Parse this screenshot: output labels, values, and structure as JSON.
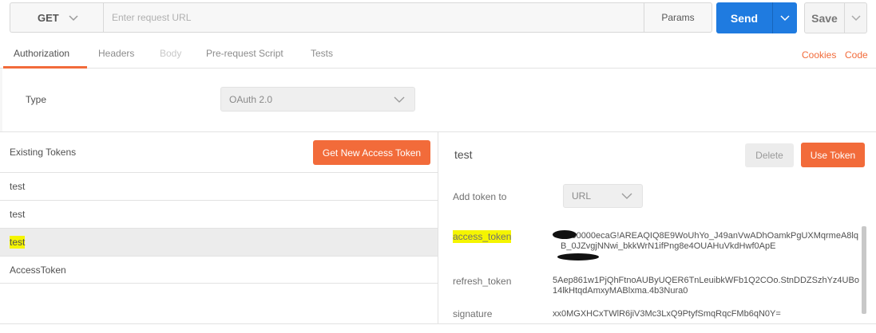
{
  "request": {
    "method": "GET",
    "url_value": "",
    "url_placeholder": "Enter request URL",
    "params_label": "Params",
    "send_label": "Send",
    "save_label": "Save"
  },
  "tabs": [
    {
      "label": "Authorization",
      "state": "active"
    },
    {
      "label": "Headers",
      "state": "normal"
    },
    {
      "label": "Body",
      "state": "disabled"
    },
    {
      "label": "Pre-request Script",
      "state": "normal"
    },
    {
      "label": "Tests",
      "state": "normal"
    }
  ],
  "links": {
    "cookies": "Cookies",
    "code": "Code"
  },
  "auth": {
    "type_label": "Type",
    "type_value": "OAuth 2.0"
  },
  "tokens": {
    "header": "Existing Tokens",
    "new_button": "Get New Access Token",
    "items": [
      {
        "name": "test"
      },
      {
        "name": "test"
      },
      {
        "name": "test"
      },
      {
        "name": "AccessToken"
      }
    ]
  },
  "detail": {
    "title": "test",
    "delete_label": "Delete",
    "use_label": "Use Token",
    "add_to_label": "Add token to",
    "add_to_value": "URL",
    "fields": [
      {
        "label": "access_token",
        "value": "A000000ecaG!AREAQIQ8E9WoUhYo_J49anVwADhOamkPgUXMqrmeA8lqB_0JZvgjNNwi_bkkWrN1ifPng8e4OUAHuVkdHwf0ApE"
      },
      {
        "label": "refresh_token",
        "value": "5Aep861w1PjQhFtnoAUByUQER6TnLeuibkWFb1Q2COo.StnDDZSzhYz4UBo14lkHtqdAmxyMABlxma.4b3Nura0"
      },
      {
        "label": "signature",
        "value": "xx0MGXHCxTWlR6jiV3Mc3LxQ9PtyfSmqRqcFMb6qN0Y="
      }
    ]
  },
  "colors": {
    "accent": "#f26b3a",
    "primary": "#1f7be0",
    "highlight": "#f5f500"
  }
}
